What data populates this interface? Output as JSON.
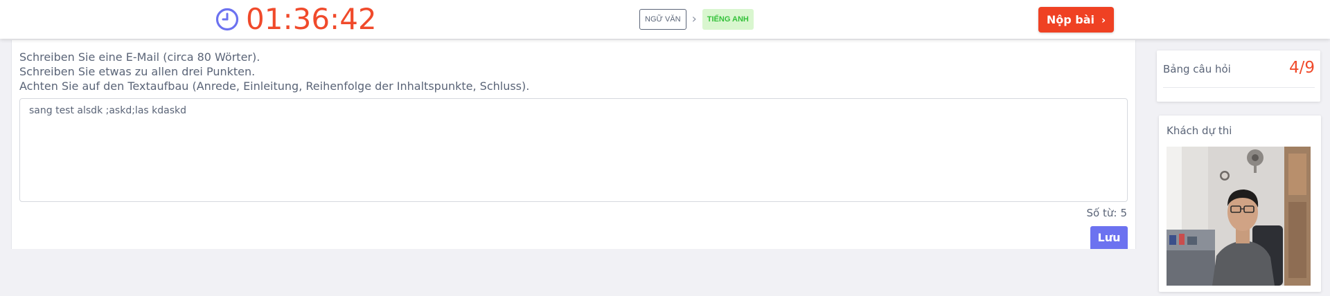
{
  "timer": {
    "time": "01:36:42",
    "icon": "clock-icon",
    "color": "#f04a2b",
    "icon_color": "#6c72f0"
  },
  "breadcrumb": {
    "from": "NGỮ VĂN",
    "separator": "›",
    "current": "TIẾNG ANH"
  },
  "submit": {
    "label": "Nộp bài",
    "chevron": "›",
    "color": "#ef4123"
  },
  "question": {
    "instructions": [
      "Schreiben Sie eine E-Mail (circa 80 Wörter).",
      "Schreiben Sie etwas zu allen drei Punkten.",
      "Achten Sie auf den Textaufbau (Anrede, Einleitung, Reihenfolge der Inhaltspunkte, Schluss)."
    ],
    "answer_text": "sang test alsdk ;askd;las kdaskd",
    "word_count_label": "Số từ:",
    "word_count_value": "5",
    "save_label": "Lưu",
    "save_color": "#6c72f0"
  },
  "question_panel": {
    "title": "Bảng câu hỏi",
    "progress": "4/9"
  },
  "candidate": {
    "title": "Khách dự thi",
    "webcam_icon": "webcam-feed"
  }
}
